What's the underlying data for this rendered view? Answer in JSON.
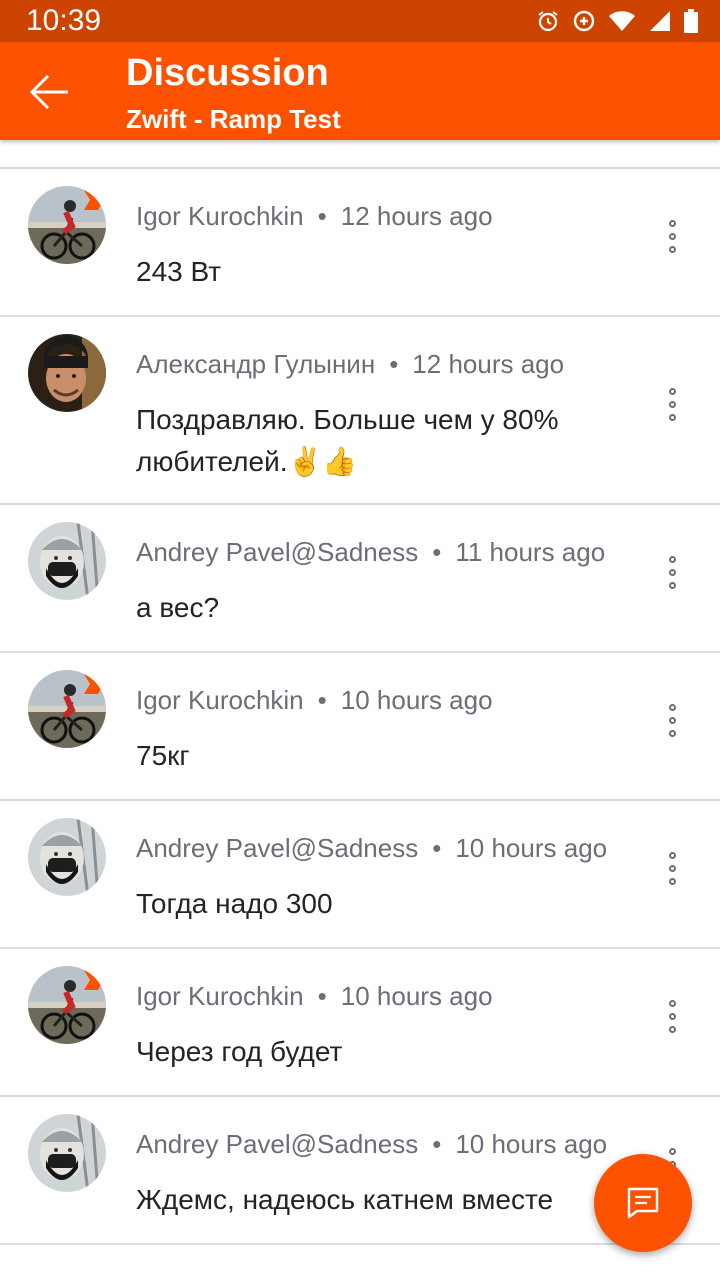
{
  "status_bar": {
    "time": "10:39",
    "icons": [
      "alarm-icon",
      "data-saver-icon",
      "wifi-icon",
      "signal-icon",
      "battery-icon"
    ]
  },
  "app_bar": {
    "title": "Discussion",
    "subtitle": "Zwift - Ramp Test",
    "back_icon": "arrow-left-icon"
  },
  "comments": [
    {
      "author": "Igor Kurochkin",
      "time": "12 hours ago",
      "text": "243 Вт",
      "avatar": "cyclist-avatar"
    },
    {
      "author": "Александр Гулынин",
      "time": "12 hours ago",
      "text": "Поздравляю. Больше чем у 80% любителей.✌️👍",
      "avatar": "man-portrait-avatar"
    },
    {
      "author": "Andrey Pavel@Sadness",
      "time": "11 hours ago",
      "text": "а вес?",
      "avatar": "masked-rider-avatar"
    },
    {
      "author": "Igor Kurochkin",
      "time": "10 hours ago",
      "text": "75кг",
      "avatar": "cyclist-avatar"
    },
    {
      "author": "Andrey Pavel@Sadness",
      "time": "10 hours ago",
      "text": "Тогда надо 300",
      "avatar": "masked-rider-avatar"
    },
    {
      "author": "Igor Kurochkin",
      "time": "10 hours ago",
      "text": "Через год будет",
      "avatar": "cyclist-avatar"
    },
    {
      "author": "Andrey Pavel@Sadness",
      "time": "10 hours ago",
      "text": "Ждемс, надеюсь катнем вместе",
      "avatar": "masked-rider-avatar"
    }
  ],
  "meta_separator": "•",
  "fab": {
    "icon": "comment-icon"
  },
  "colors": {
    "accent": "#fc5200",
    "status_bar": "#cc4400",
    "meta_text": "#6d6d78",
    "body_text": "#242428",
    "divider": "#dddddd"
  }
}
